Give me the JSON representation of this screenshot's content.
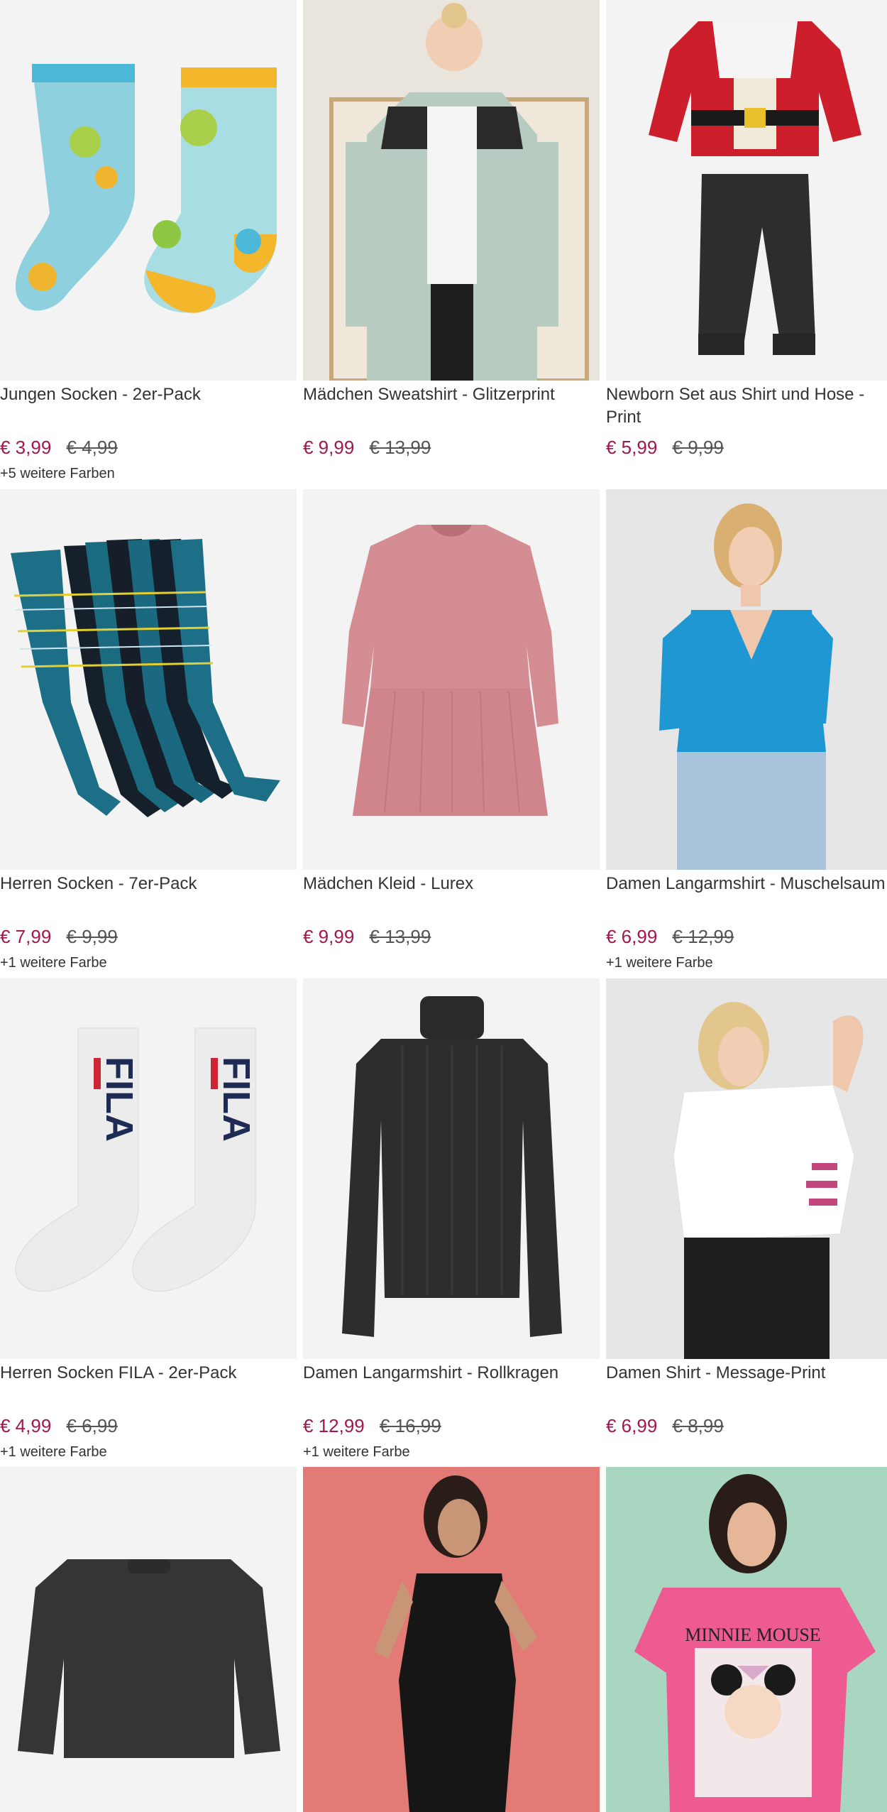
{
  "products": [
    {
      "title": "Jungen Socken - 2er-Pack",
      "price_now": "€ 3,99",
      "price_old": "€ 4,99",
      "colors": "+5 weitere Farben",
      "image": "kids-monster-socks"
    },
    {
      "title": "Mädchen Sweatshirt - Glitzerprint",
      "price_now": "€ 9,99",
      "price_old": "€ 13,99",
      "colors": "",
      "image": "girl-puffer-jacket-photo"
    },
    {
      "title": "Newborn Set aus Shirt und Hose - Print",
      "price_now": "€ 5,99",
      "price_old": "€ 9,99",
      "colors": "",
      "image": "santa-shirt-and-black-pants"
    },
    {
      "title": "Herren Socken - 7er-Pack",
      "price_now": "€ 7,99",
      "price_old": "€ 9,99",
      "colors": "+1 weitere Farbe",
      "image": "striped-socks-pack"
    },
    {
      "title": "Mädchen Kleid - Lurex",
      "price_now": "€ 9,99",
      "price_old": "€ 13,99",
      "colors": "",
      "image": "pink-dress"
    },
    {
      "title": "Damen Langarmshirt - Muschelsaum",
      "price_now": "€ 6,99",
      "price_old": "€ 12,99",
      "colors": "+1 weitere Farbe",
      "image": "woman-blue-top-photo"
    },
    {
      "title": "Herren Socken FILA - 2er-Pack",
      "price_now": "€ 4,99",
      "price_old": "€ 6,99",
      "colors": "+1 weitere Farbe",
      "image": "fila-white-socks"
    },
    {
      "title": "Damen Langarmshirt - Rollkragen",
      "price_now": "€ 12,99",
      "price_old": "€ 16,99",
      "colors": "+1 weitere Farbe",
      "image": "black-turtleneck"
    },
    {
      "title": "Damen Shirt - Message-Print",
      "price_now": "€ 6,99",
      "price_old": "€ 8,99",
      "colors": "",
      "image": "woman-white-tee-photo"
    },
    {
      "title": "",
      "price_now": "",
      "price_old": "",
      "colors": "",
      "image": "dark-gray-sweatshirt"
    },
    {
      "title": "",
      "price_now": "",
      "price_old": "",
      "colors": "",
      "image": "woman-black-dress-photo"
    },
    {
      "title": "",
      "price_now": "",
      "price_old": "",
      "colors": "",
      "image": "woman-pink-minnie-tee-photo"
    }
  ],
  "image_text": {
    "fila_logo": "FILA",
    "minnie_print": "MINNIE MOUSE"
  },
  "colors": {
    "price_accent": "#a3174f",
    "text": "#333333",
    "image_bg": "#f2f2f2"
  }
}
